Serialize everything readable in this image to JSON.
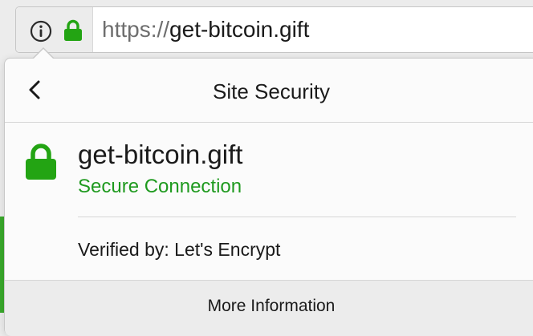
{
  "urlbar": {
    "scheme": "https://",
    "host": "get-bitcoin.gift"
  },
  "panel": {
    "title": "Site Security",
    "site_host": "get-bitcoin.gift",
    "connection_status": "Secure Connection",
    "verified_by": "Verified by: Let's Encrypt",
    "more_info_label": "More Information"
  },
  "colors": {
    "secure_green": "#1f9a1f",
    "lock_green": "#23a413",
    "panel_bg": "#fbfbfb",
    "footer_bg": "#ececec"
  },
  "icons": {
    "identity_info": "info-circle-icon",
    "identity_lock": "lock-icon",
    "back": "chevron-left-icon",
    "site_lock": "lock-icon"
  }
}
